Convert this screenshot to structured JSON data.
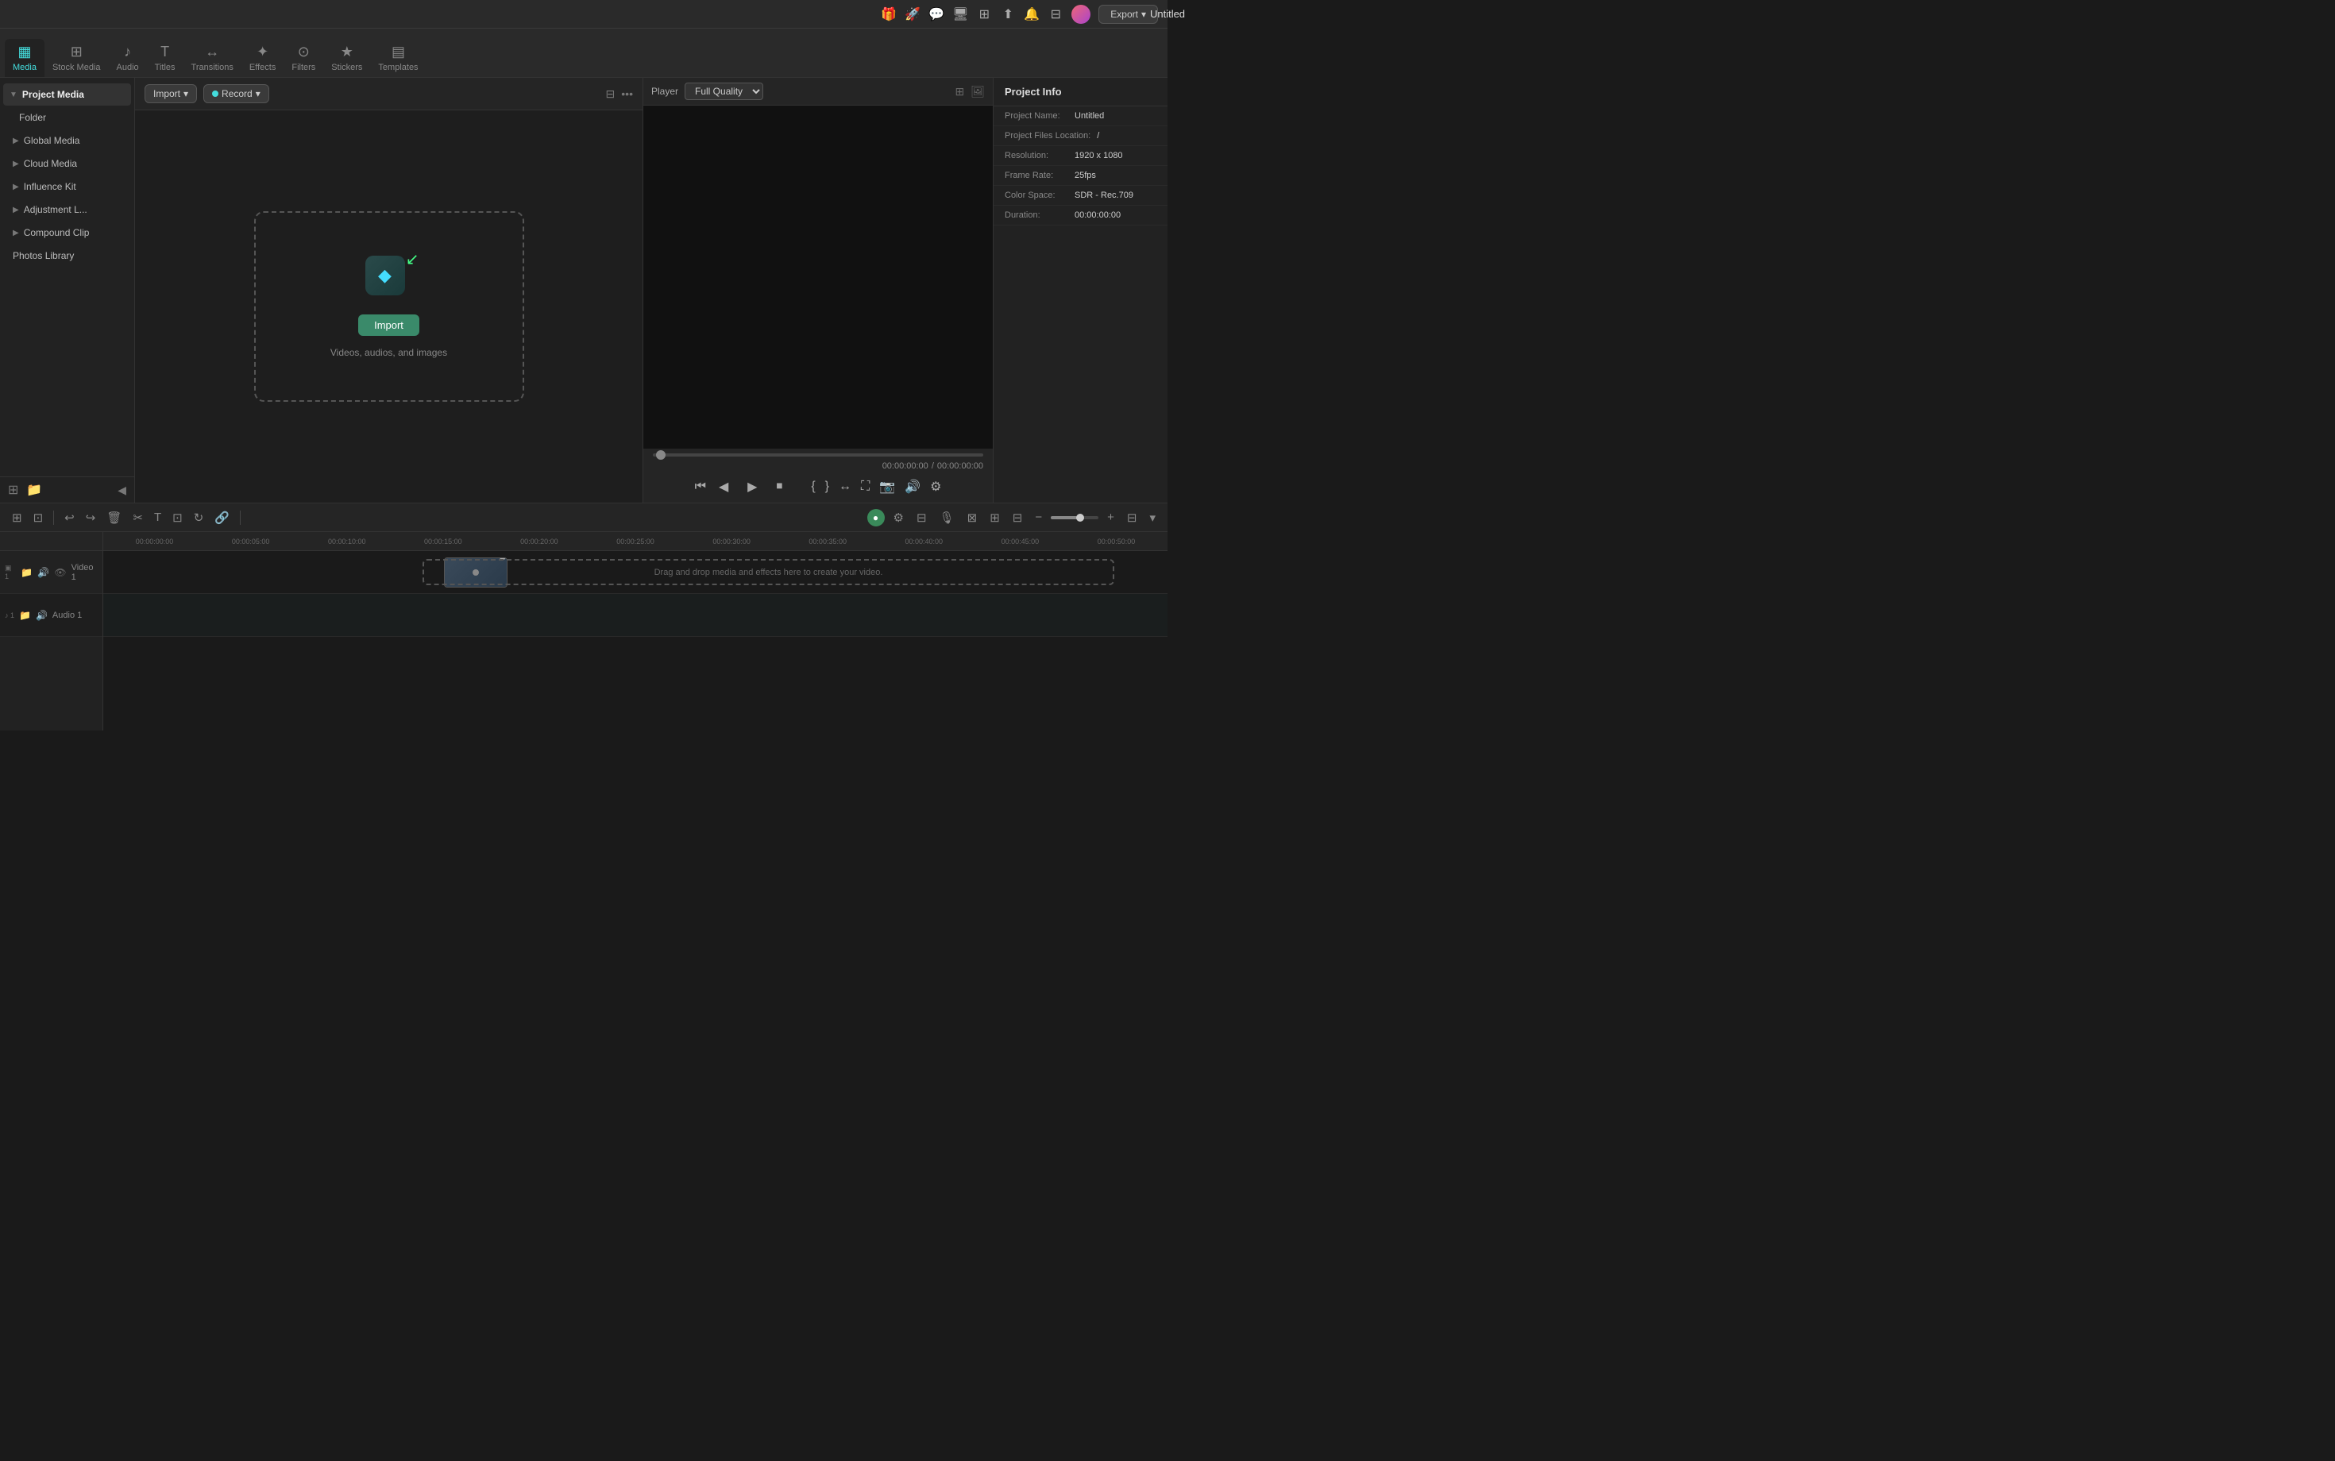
{
  "app": {
    "title": "Untitled"
  },
  "topbar": {
    "icons": [
      "gift",
      "rocket",
      "chat",
      "display",
      "grid",
      "upload",
      "bell",
      "grid2"
    ],
    "export_label": "Export",
    "export_arrow": "▾"
  },
  "media_tabs": [
    {
      "id": "media",
      "label": "Media",
      "icon": "▦",
      "active": true
    },
    {
      "id": "stock",
      "label": "Stock Media",
      "icon": "⊞"
    },
    {
      "id": "audio",
      "label": "Audio",
      "icon": "♪"
    },
    {
      "id": "titles",
      "label": "Titles",
      "icon": "T"
    },
    {
      "id": "transitions",
      "label": "Transitions",
      "icon": "↔"
    },
    {
      "id": "effects",
      "label": "Effects",
      "icon": "✦"
    },
    {
      "id": "filters",
      "label": "Filters",
      "icon": "⊙"
    },
    {
      "id": "stickers",
      "label": "Stickers",
      "icon": "★"
    },
    {
      "id": "templates",
      "label": "Templates",
      "icon": "▤"
    }
  ],
  "sidebar": {
    "project_media_label": "Project Media",
    "folder_label": "Folder",
    "global_media_label": "Global Media",
    "cloud_media_label": "Cloud Media",
    "influence_kit_label": "Influence Kit",
    "adjustment_layer_label": "Adjustment L...",
    "compound_clip_label": "Compound Clip",
    "photos_library_label": "Photos Library"
  },
  "import_bar": {
    "import_label": "Import",
    "record_label": "Record",
    "filter_icon": "filter",
    "more_icon": "more"
  },
  "drop_zone": {
    "import_button": "Import",
    "subtitle": "Videos, audios, and images"
  },
  "player": {
    "label": "Player",
    "quality": "Full Quality",
    "current_time": "00:00:00:00",
    "total_time": "00:00:00:00",
    "separator": "/"
  },
  "project_info": {
    "header": "Project Info",
    "rows": [
      {
        "label": "Project Name:",
        "value": "Untitled"
      },
      {
        "label": "Project Files Location:",
        "value": "/"
      },
      {
        "label": "Resolution:",
        "value": "1920 x 1080"
      },
      {
        "label": "Frame Rate:",
        "value": "25fps"
      },
      {
        "label": "Color Space:",
        "value": "SDR - Rec.709"
      },
      {
        "label": "Duration:",
        "value": "00:00:00:00"
      }
    ]
  },
  "timeline": {
    "ruler_marks": [
      "00:00:00:00",
      "00:00:05:00",
      "00:00:10:00",
      "00:00:15:00",
      "00:00:20:00",
      "00:00:25:00",
      "00:00:30:00",
      "00:00:35:00",
      "00:00:40:00",
      "00:00:45:00",
      "00:00:50:00"
    ],
    "tracks": [
      {
        "id": "video1",
        "name": "Video 1",
        "type": "video",
        "track_num": "1"
      },
      {
        "id": "audio1",
        "name": "Audio 1",
        "type": "audio",
        "track_num": "1"
      }
    ],
    "drop_hint": "Drag and drop media and effects here to create your video."
  }
}
